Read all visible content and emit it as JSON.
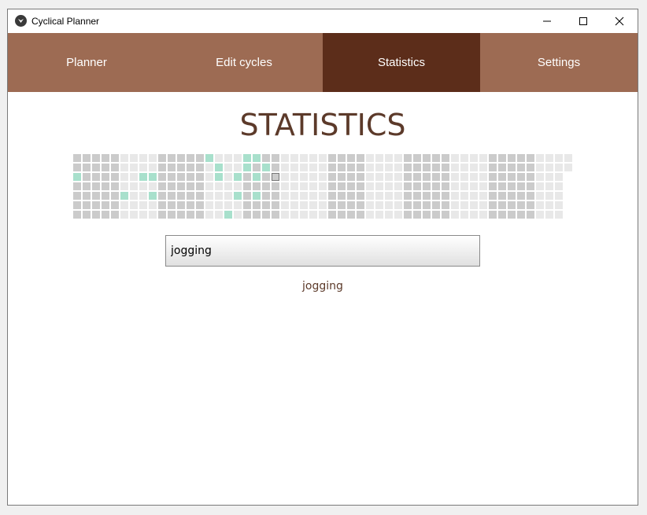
{
  "window": {
    "title": "Cyclical Planner",
    "icon": "app-logo-icon"
  },
  "controls": {
    "minimize_icon": "minimize-icon",
    "maximize_icon": "maximize-icon",
    "close_icon": "close-icon"
  },
  "tabs": [
    {
      "label": "Planner",
      "active": false
    },
    {
      "label": "Edit cycles",
      "active": false
    },
    {
      "label": "Statistics",
      "active": true
    },
    {
      "label": "Settings",
      "active": false
    }
  ],
  "heading": "STATISTICS",
  "search": {
    "value": "jogging",
    "placeholder": ""
  },
  "result": "jogging",
  "colors": {
    "tab_bg": "#9d6b53",
    "tab_active_bg": "#5c2d1a",
    "heading": "#5c3a2a",
    "cell_dark": "#cbcbcb",
    "cell_light": "#e8e8e8",
    "cell_done": "#a8e0cc",
    "cell_today_border": "#777777"
  },
  "calendar": {
    "week_count": 53,
    "days_per_week": 7,
    "first_day_row": 1,
    "today": {
      "week": 21,
      "day": 2
    },
    "done_days": [
      {
        "week": 0,
        "day": 2
      },
      {
        "week": 5,
        "day": 4
      },
      {
        "week": 7,
        "day": 2
      },
      {
        "week": 8,
        "day": 2
      },
      {
        "week": 8,
        "day": 4
      },
      {
        "week": 14,
        "day": 0
      },
      {
        "week": 15,
        "day": 1
      },
      {
        "week": 15,
        "day": 2
      },
      {
        "week": 16,
        "day": 6
      },
      {
        "week": 17,
        "day": 2
      },
      {
        "week": 17,
        "day": 4
      },
      {
        "week": 18,
        "day": 0
      },
      {
        "week": 18,
        "day": 1
      },
      {
        "week": 19,
        "day": 0
      },
      {
        "week": 19,
        "day": 2
      },
      {
        "week": 19,
        "day": 4
      },
      {
        "week": 20,
        "day": 1
      }
    ]
  }
}
